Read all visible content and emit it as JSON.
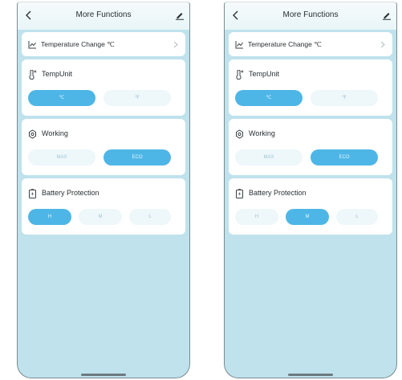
{
  "screens": [
    {
      "title": "More Functions",
      "temperature_change": {
        "label": "Temperature Change ℃"
      },
      "temp_unit": {
        "label": "TempUnit",
        "options": [
          "℃",
          "℉"
        ],
        "selected": "℃"
      },
      "working": {
        "label": "Working",
        "options": [
          "MAX",
          "ECO"
        ],
        "selected": "ECO"
      },
      "battery_protection": {
        "label": "Battery Protection",
        "options": [
          "H",
          "M",
          "L"
        ],
        "selected": "H"
      }
    },
    {
      "title": "More Functions",
      "temperature_change": {
        "label": "Temperature Change ℃"
      },
      "temp_unit": {
        "label": "TempUnit",
        "options": [
          "℃",
          "℉"
        ],
        "selected": "℃"
      },
      "working": {
        "label": "Working",
        "options": [
          "MAX",
          "ECO"
        ],
        "selected": "ECO"
      },
      "battery_protection": {
        "label": "Battery Protection",
        "options": [
          "H",
          "M",
          "L"
        ],
        "selected": "M"
      }
    }
  ],
  "icons": {
    "back": "chevron-left-icon",
    "edit": "pencil-icon",
    "temperature_change": "line-chart-icon",
    "temp_unit": "thermometer-icon",
    "working": "gear-icon",
    "battery_protection": "battery-bolt-icon",
    "chevron": "chevron-right-icon"
  },
  "colors": {
    "background": "#bfe2ec",
    "selected": "#4eb6e6",
    "unselected": "#eef7fa"
  }
}
